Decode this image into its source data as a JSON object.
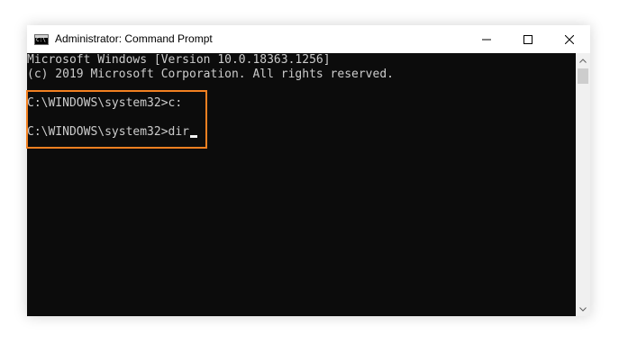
{
  "window": {
    "title": "Administrator: Command Prompt",
    "icon": "cmd-app-icon"
  },
  "controls": {
    "minimize_icon": "minimize-icon",
    "maximize_icon": "maximize-icon",
    "close_icon": "close-icon"
  },
  "terminal": {
    "lines": [
      "Microsoft Windows [Version 10.0.18363.1256]",
      "(c) 2019 Microsoft Corporation. All rights reserved.",
      "C:\\WINDOWS\\system32>c:",
      "C:\\WINDOWS\\system32>dir"
    ]
  },
  "colors": {
    "terminal_bg": "#0c0c0c",
    "terminal_text": "#cccccc",
    "highlight": "#f28021"
  }
}
